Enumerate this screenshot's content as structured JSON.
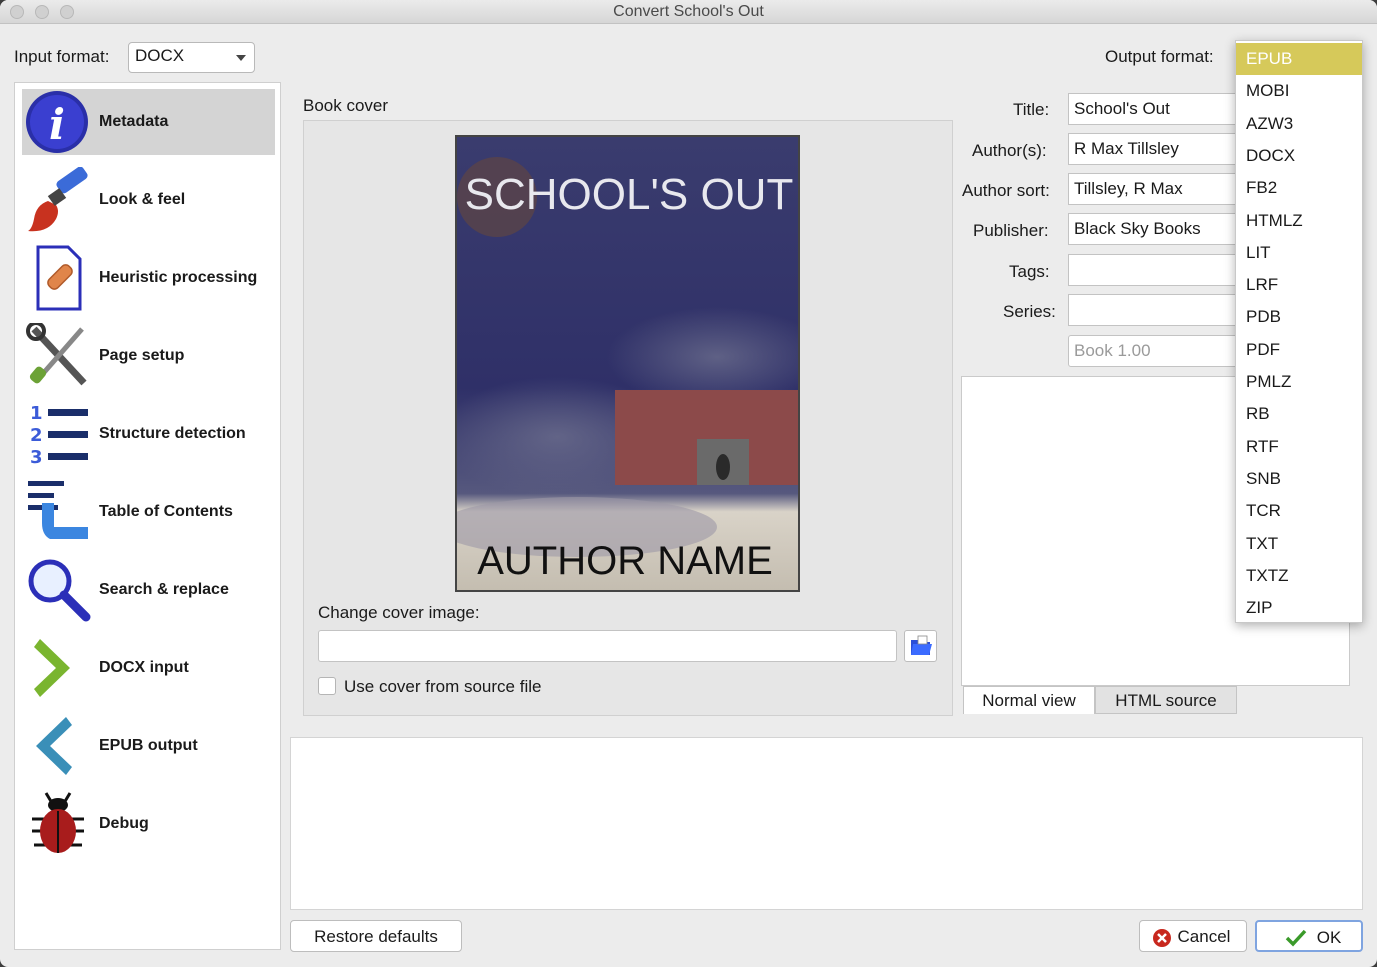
{
  "window": {
    "title": "Convert School's Out"
  },
  "input_format": {
    "label": "Input format:",
    "value": "DOCX"
  },
  "output_format": {
    "label": "Output format:",
    "selected": "EPUB",
    "options": [
      "EPUB",
      "MOBI",
      "AZW3",
      "DOCX",
      "FB2",
      "HTMLZ",
      "LIT",
      "LRF",
      "PDB",
      "PDF",
      "PMLZ",
      "RB",
      "RTF",
      "SNB",
      "TCR",
      "TXT",
      "TXTZ",
      "ZIP"
    ]
  },
  "sidebar": {
    "items": [
      {
        "label": "Metadata",
        "icon": "info-icon",
        "selected": true
      },
      {
        "label": "Look & feel",
        "icon": "paintbrush-icon"
      },
      {
        "label": "Heuristic processing",
        "icon": "document-patch-icon"
      },
      {
        "label": "Page setup",
        "icon": "tools-icon"
      },
      {
        "label": "Structure detection",
        "icon": "numbered-list-icon"
      },
      {
        "label": "Table of Contents",
        "icon": "toc-hand-icon"
      },
      {
        "label": "Search & replace",
        "icon": "magnifier-icon"
      },
      {
        "label": "DOCX input",
        "icon": "chevron-right-icon"
      },
      {
        "label": "EPUB output",
        "icon": "chevron-left-icon"
      },
      {
        "label": "Debug",
        "icon": "bug-icon"
      }
    ]
  },
  "book_cover": {
    "label": "Book cover",
    "cover_title": "SCHOOL'S OUT",
    "cover_author": "AUTHOR NAME",
    "change_label": "Change cover image:",
    "path_value": "",
    "use_source_label": "Use cover from source file",
    "use_source_checked": false
  },
  "metadata": {
    "title_label": "Title:",
    "title": "School's Out",
    "authors_label": "Author(s):",
    "authors": "R Max Tillsley",
    "author_sort_label": "Author sort:",
    "author_sort": "Tillsley, R Max",
    "publisher_label": "Publisher:",
    "publisher": "Black Sky Books",
    "tags_label": "Tags:",
    "tags": "",
    "series_label": "Series:",
    "series": "",
    "series_index_placeholder": "Book 1.00"
  },
  "tabs": {
    "normal": "Normal view",
    "html": "HTML source"
  },
  "buttons": {
    "restore": "Restore defaults",
    "cancel": "Cancel",
    "ok": "OK"
  },
  "colors": {
    "dropdown_selected": "#d6c95a",
    "accent": "#3b5bd8"
  }
}
